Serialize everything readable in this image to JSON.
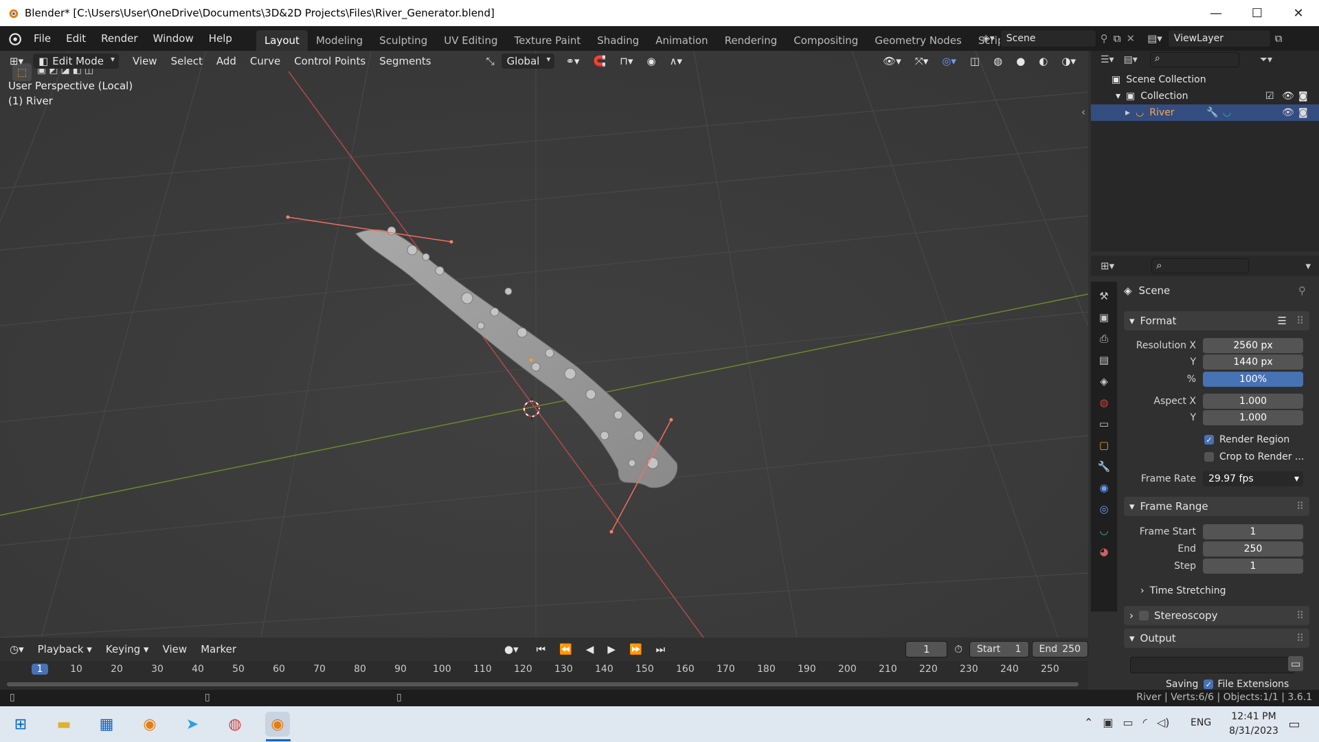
{
  "window": {
    "title": "Blender* [C:\\Users\\User\\OneDrive\\Documents\\3D&2D Projects\\Files\\River_Generator.blend]",
    "minimize": "—",
    "maximize": "☐",
    "close": "✕"
  },
  "menus": [
    "File",
    "Edit",
    "Render",
    "Window",
    "Help"
  ],
  "workspaces": [
    "Layout",
    "Modeling",
    "Sculpting",
    "UV Editing",
    "Texture Paint",
    "Shading",
    "Animation",
    "Rendering",
    "Compositing",
    "Geometry Nodes",
    "Scripting"
  ],
  "add_workspace": "+",
  "scene_selector": "Scene",
  "viewlayer_selector": "ViewLayer",
  "viewport_header": {
    "mode": "Edit Mode",
    "menus": [
      "View",
      "Select",
      "Add",
      "Curve",
      "Control Points",
      "Segments"
    ],
    "orientation": "Global"
  },
  "viewport": {
    "perspective_label": "User Perspective (Local)",
    "object_label": "(1) River"
  },
  "outliner": {
    "scene_collection": "Scene Collection",
    "collection": "Collection",
    "river": "River"
  },
  "properties": {
    "scene_label": "Scene",
    "format_header": "Format",
    "resolution_x_label": "Resolution X",
    "resolution_x": "2560 px",
    "resolution_y_label": "Y",
    "resolution_y": "1440 px",
    "percent_label": "%",
    "percent": "100%",
    "aspect_x_label": "Aspect X",
    "aspect_x": "1.000",
    "aspect_y_label": "Y",
    "aspect_y": "1.000",
    "render_region": "Render Region",
    "crop_to_render": "Crop to Render ...",
    "frame_rate_label": "Frame Rate",
    "frame_rate": "29.97 fps",
    "frame_range_header": "Frame Range",
    "frame_start_label": "Frame Start",
    "frame_start": "1",
    "end_label": "End",
    "end": "250",
    "step_label": "Step",
    "step": "1",
    "time_stretching": "Time Stretching",
    "stereoscopy": "Stereoscopy",
    "output_header": "Output",
    "saving_label": "Saving",
    "file_extensions": "File Extensions"
  },
  "timeline": {
    "menus": [
      "Playback",
      "Keying",
      "View",
      "Marker"
    ],
    "current_frame": "1",
    "start_label": "Start",
    "start": "1",
    "end_label": "End",
    "end": "250",
    "ruler": [
      "1",
      "10",
      "20",
      "30",
      "40",
      "50",
      "60",
      "70",
      "80",
      "90",
      "100",
      "110",
      "120",
      "130",
      "140",
      "150",
      "160",
      "170",
      "180",
      "190",
      "200",
      "210",
      "220",
      "230",
      "240",
      "250"
    ]
  },
  "statusbar": {
    "right": "River | Verts:6/6 | Objects:1/1 | 3.6.1"
  },
  "taskbar": {
    "language": "ENG",
    "time": "12:41 PM",
    "date": "8/31/2023"
  }
}
